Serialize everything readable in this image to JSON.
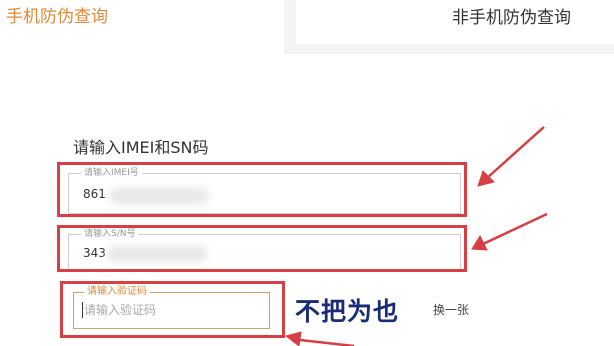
{
  "tabs": {
    "phone": "手机防伪查询",
    "non_phone": "非手机防伪查询"
  },
  "form": {
    "heading": "请输入IMEI和SN码",
    "imei": {
      "legend": "请输入IMEI号",
      "value": "861"
    },
    "sn": {
      "legend": "请输入S/N号",
      "value": "343"
    },
    "captcha": {
      "legend": "请输入验证码",
      "placeholder": "请输入验证码",
      "image_text": "不把为也",
      "refresh_label": "换一张"
    }
  },
  "colors": {
    "accent": "#e0893a",
    "highlight": "#d64044",
    "captcha_text": "#1a2a7a"
  }
}
